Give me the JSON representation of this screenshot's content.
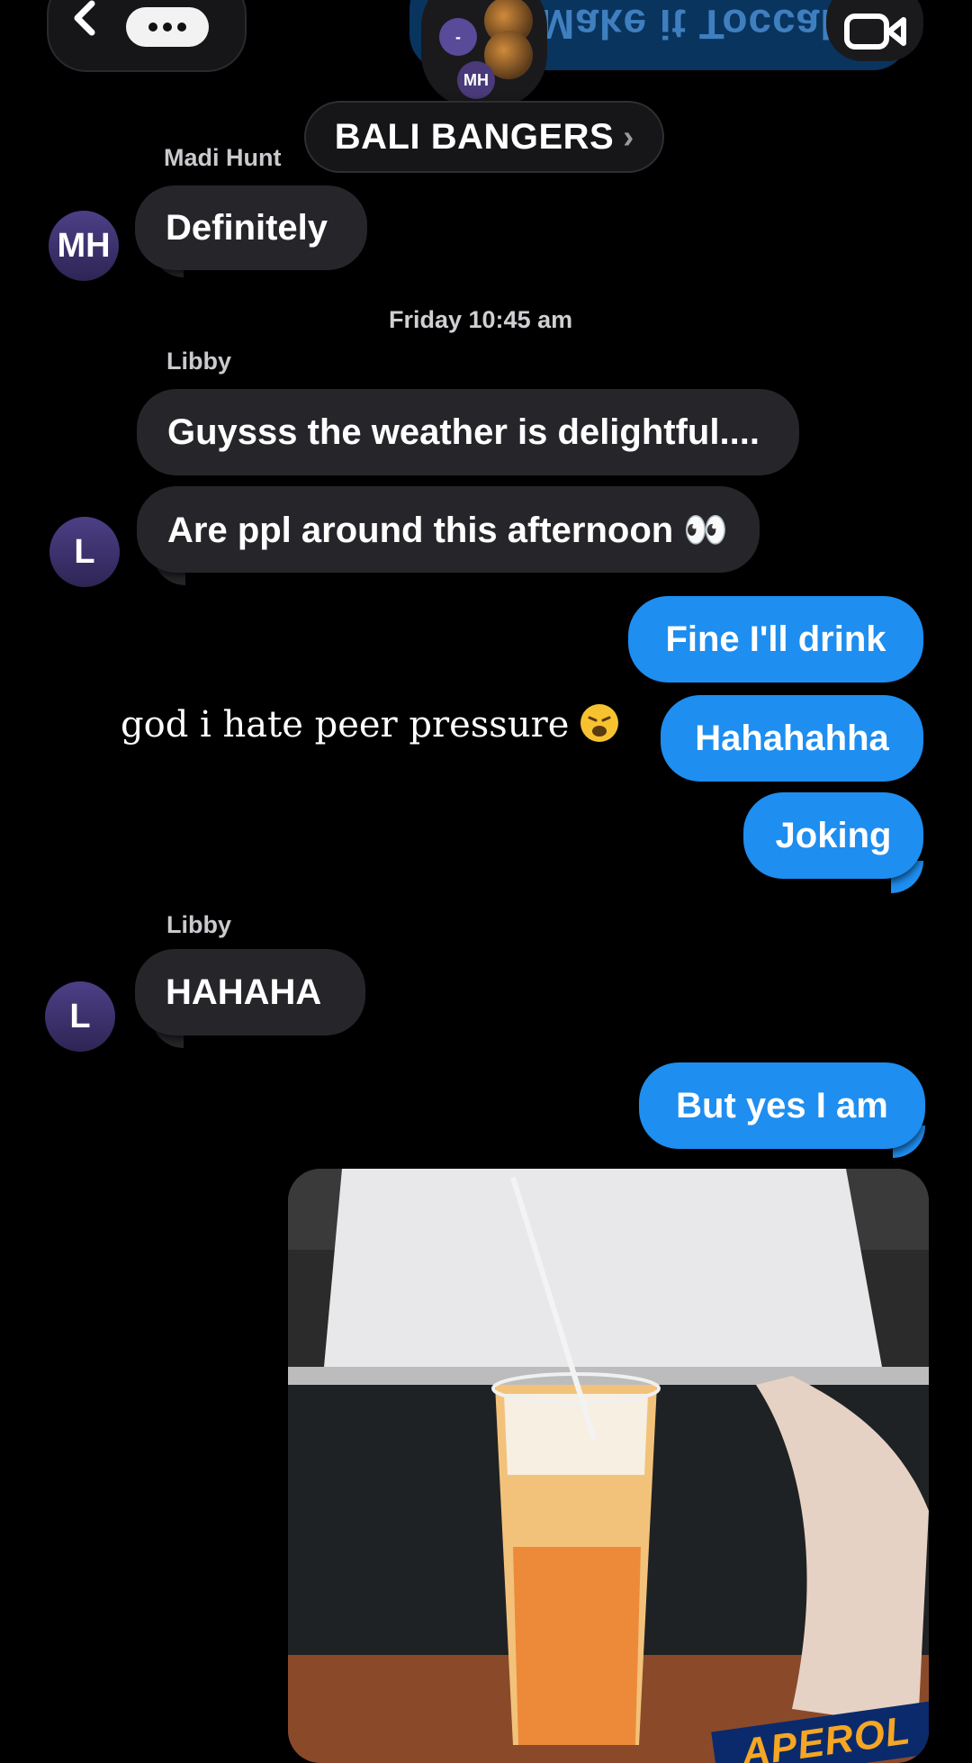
{
  "header": {
    "group_name": "BALI BANGERS",
    "chevron": "›",
    "mirrored_text": "Make it Toccal!",
    "avatars": [
      "MH",
      "-"
    ],
    "back_icon": "chevron-left-icon",
    "more_icon": "ellipsis-icon",
    "video_icon": "video-camera-icon"
  },
  "messages": {
    "m1_sender": "Madi Hunt",
    "m1_text": "Definitely",
    "m1_avatar": "MH",
    "timestamp": "Friday 10:45 am",
    "m2_sender": "Libby",
    "m2_text": "Guysss the weather is delightful....",
    "m3_text": "Are ppl around this afternoon 👀",
    "m3_avatar": "L",
    "o1_text": "Fine I'll drink",
    "o2_text": "Hahahahha",
    "o3_text": "Joking",
    "m4_sender": "Libby",
    "m4_text": "HAHAHA",
    "m4_avatar": "L",
    "o4_text": "But yes I am"
  },
  "overlay": {
    "caption": "god i hate peer pressure",
    "emoji": "weary-face-emoji"
  },
  "photo": {
    "brand_text": "APEROL"
  },
  "colors": {
    "outgoing": "#1e8ef0",
    "incoming": "#26262a",
    "avatar": "#4d3f86"
  }
}
